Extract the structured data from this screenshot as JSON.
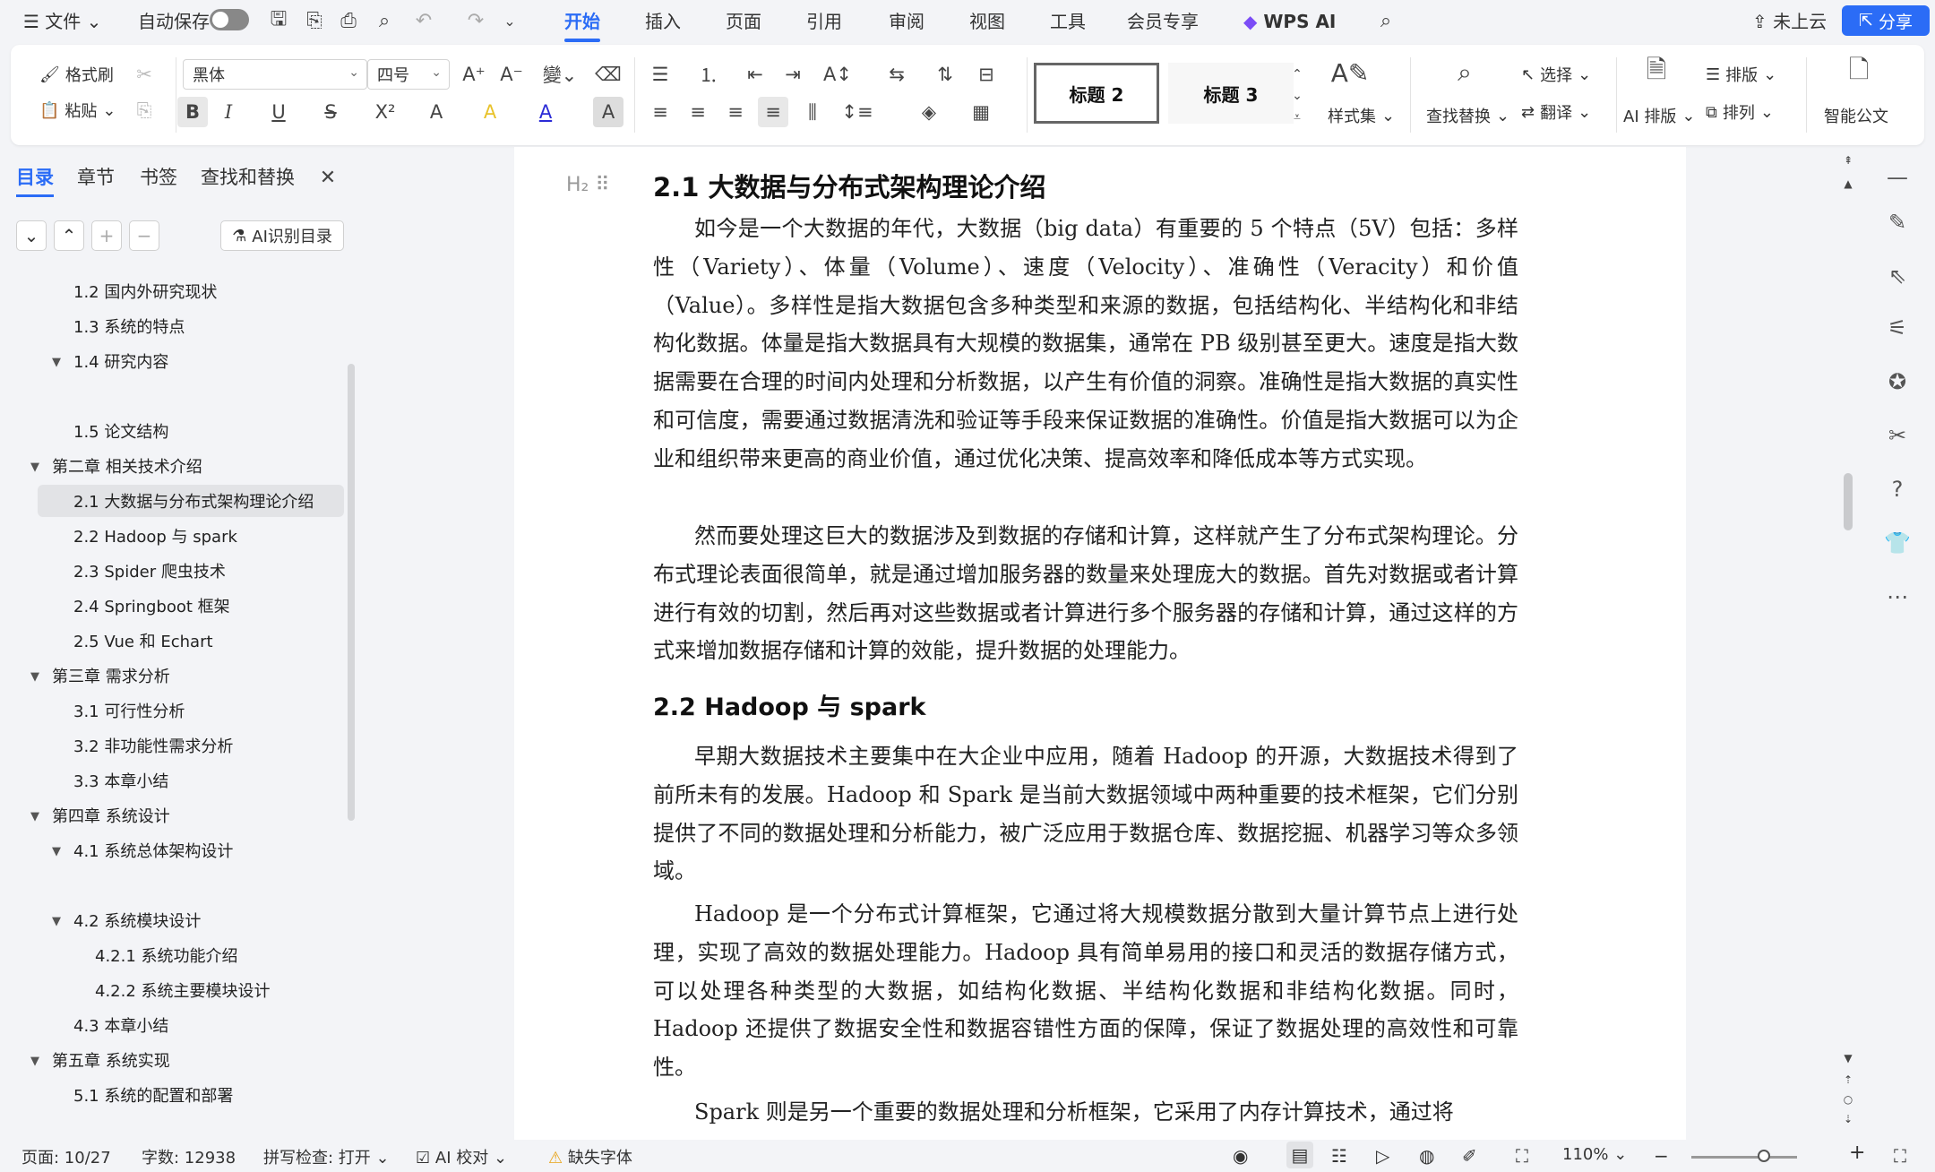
{
  "menubar": {
    "file": "文件",
    "autosave": "自动保存",
    "tabs": [
      "开始",
      "插入",
      "页面",
      "引用",
      "审阅",
      "视图",
      "工具",
      "会员专享"
    ],
    "wps_ai": "WPS AI",
    "cloud": "未上云",
    "share": "分享"
  },
  "ribbon": {
    "format_painter": "格式刷",
    "paste": "粘贴",
    "font_name": "黑体",
    "font_size": "四号",
    "style1": "标题 2",
    "style2": "标题 3",
    "style_set": "样式集",
    "find_replace": "查找替换",
    "select": "选择",
    "translate": "翻译",
    "ai_layout": "AI 排版",
    "typeset": "排版",
    "arrange": "排列",
    "smart_doc": "智能公文",
    "bold": "B",
    "italic": "I",
    "underline": "U",
    "strike": "S",
    "superscript": "X²",
    "text_a": "A",
    "highlight": "A",
    "char_shade": "A"
  },
  "leftpanel": {
    "tabs": [
      "目录",
      "章节",
      "书签",
      "查找和替换"
    ],
    "ai_toc": "AI识别目录",
    "toc": [
      {
        "label": "1.2 国内外研究现状"
      },
      {
        "label": "1.3 系统的特点"
      },
      {
        "label": "1.4 研究内容"
      },
      {
        "label": "1.5 论文结构"
      },
      {
        "label": "第二章  相关技术介绍"
      },
      {
        "label": "2.1  大数据与分布式架构理论介绍"
      },
      {
        "label": "2.2 Hadoop 与 spark"
      },
      {
        "label": "2.3 Spider 爬虫技术"
      },
      {
        "label": "2.4 Springboot 框架"
      },
      {
        "label": "2.5 Vue 和 Echart"
      },
      {
        "label": "第三章  需求分析"
      },
      {
        "label": "3.1 可行性分析"
      },
      {
        "label": "3.2  非功能性需求分析"
      },
      {
        "label": "3.3 本章小结"
      },
      {
        "label": "第四章  系统设计"
      },
      {
        "label": "4.1  系统总体架构设计"
      },
      {
        "label": "4.2  系统模块设计"
      },
      {
        "label": "4.2.1 系统功能介绍"
      },
      {
        "label": "4.2.2 系统主要模块设计"
      },
      {
        "label": "4.3  本章小结"
      },
      {
        "label": "第五章  系统实现"
      },
      {
        "label": "5.1  系统的配置和部署"
      }
    ]
  },
  "document": {
    "heading_marker": "H₂",
    "h1": "2.1  大数据与分布式架构理论介绍",
    "p1": "如今是一个大数据的年代，大数据（big data）有重要的 5 个特点（5V）包括：多样性（Variety）、体量（Volume）、速度（Velocity）、准确性（Veracity）和价值（Value）。多样性是指大数据包含多种类型和来源的数据，包括结构化、半结构化和非结构化数据。体量是指大数据具有大规模的数据集，通常在 PB 级别甚至更大。速度是指大数据需要在合理的时间内处理和分析数据，以产生有价值的洞察。准确性是指大数据的真实性和可信度，需要通过数据清洗和验证等手段来保证数据的准确性。价值是指大数据可以为企业和组织带来更高的商业价值，通过优化决策、提高效率和降低成本等方式实现。",
    "p2": "然而要处理这巨大的数据涉及到数据的存储和计算，这样就产生了分布式架构理论。分布式理论表面很简单，就是通过增加服务器的数量来处理庞大的数据。首先对数据或者计算进行有效的切割，然后再对这些数据或者计算进行多个服务器的存储和计算，通过这样的方式来增加数据存储和计算的效能，提升数据的处理能力。",
    "h2": "2.2 Hadoop 与 spark",
    "p3": "早期大数据技术主要集中在大企业中应用，随着 Hadoop 的开源，大数据技术得到了前所未有的发展。Hadoop 和 Spark 是当前大数据领域中两种重要的技术框架，它们分别提供了不同的数据处理和分析能力，被广泛应用于数据仓库、数据挖掘、机器学习等众多领域。",
    "p4": "Hadoop 是一个分布式计算框架，它通过将大规模数据分散到大量计算节点上进行处理，实现了高效的数据处理能力。Hadoop 具有简单易用的接口和灵活的数据存储方式，可以处理各种类型的大数据，如结构化数据、半结构化数据和非结构化数据。同时，Hadoop 还提供了数据安全性和数据容错性方面的保障，保证了数据处理的高效性和可靠性。",
    "p5": "Spark 则是另一个重要的数据处理和分析框架，它采用了内存计算技术，通过将"
  },
  "status": {
    "page": "页面: 10/27",
    "words": "字数: 12938",
    "spell": "拼写检查: 打开",
    "ai_check": "AI 校对",
    "missing_font": "缺失字体",
    "zoom": "110%"
  }
}
